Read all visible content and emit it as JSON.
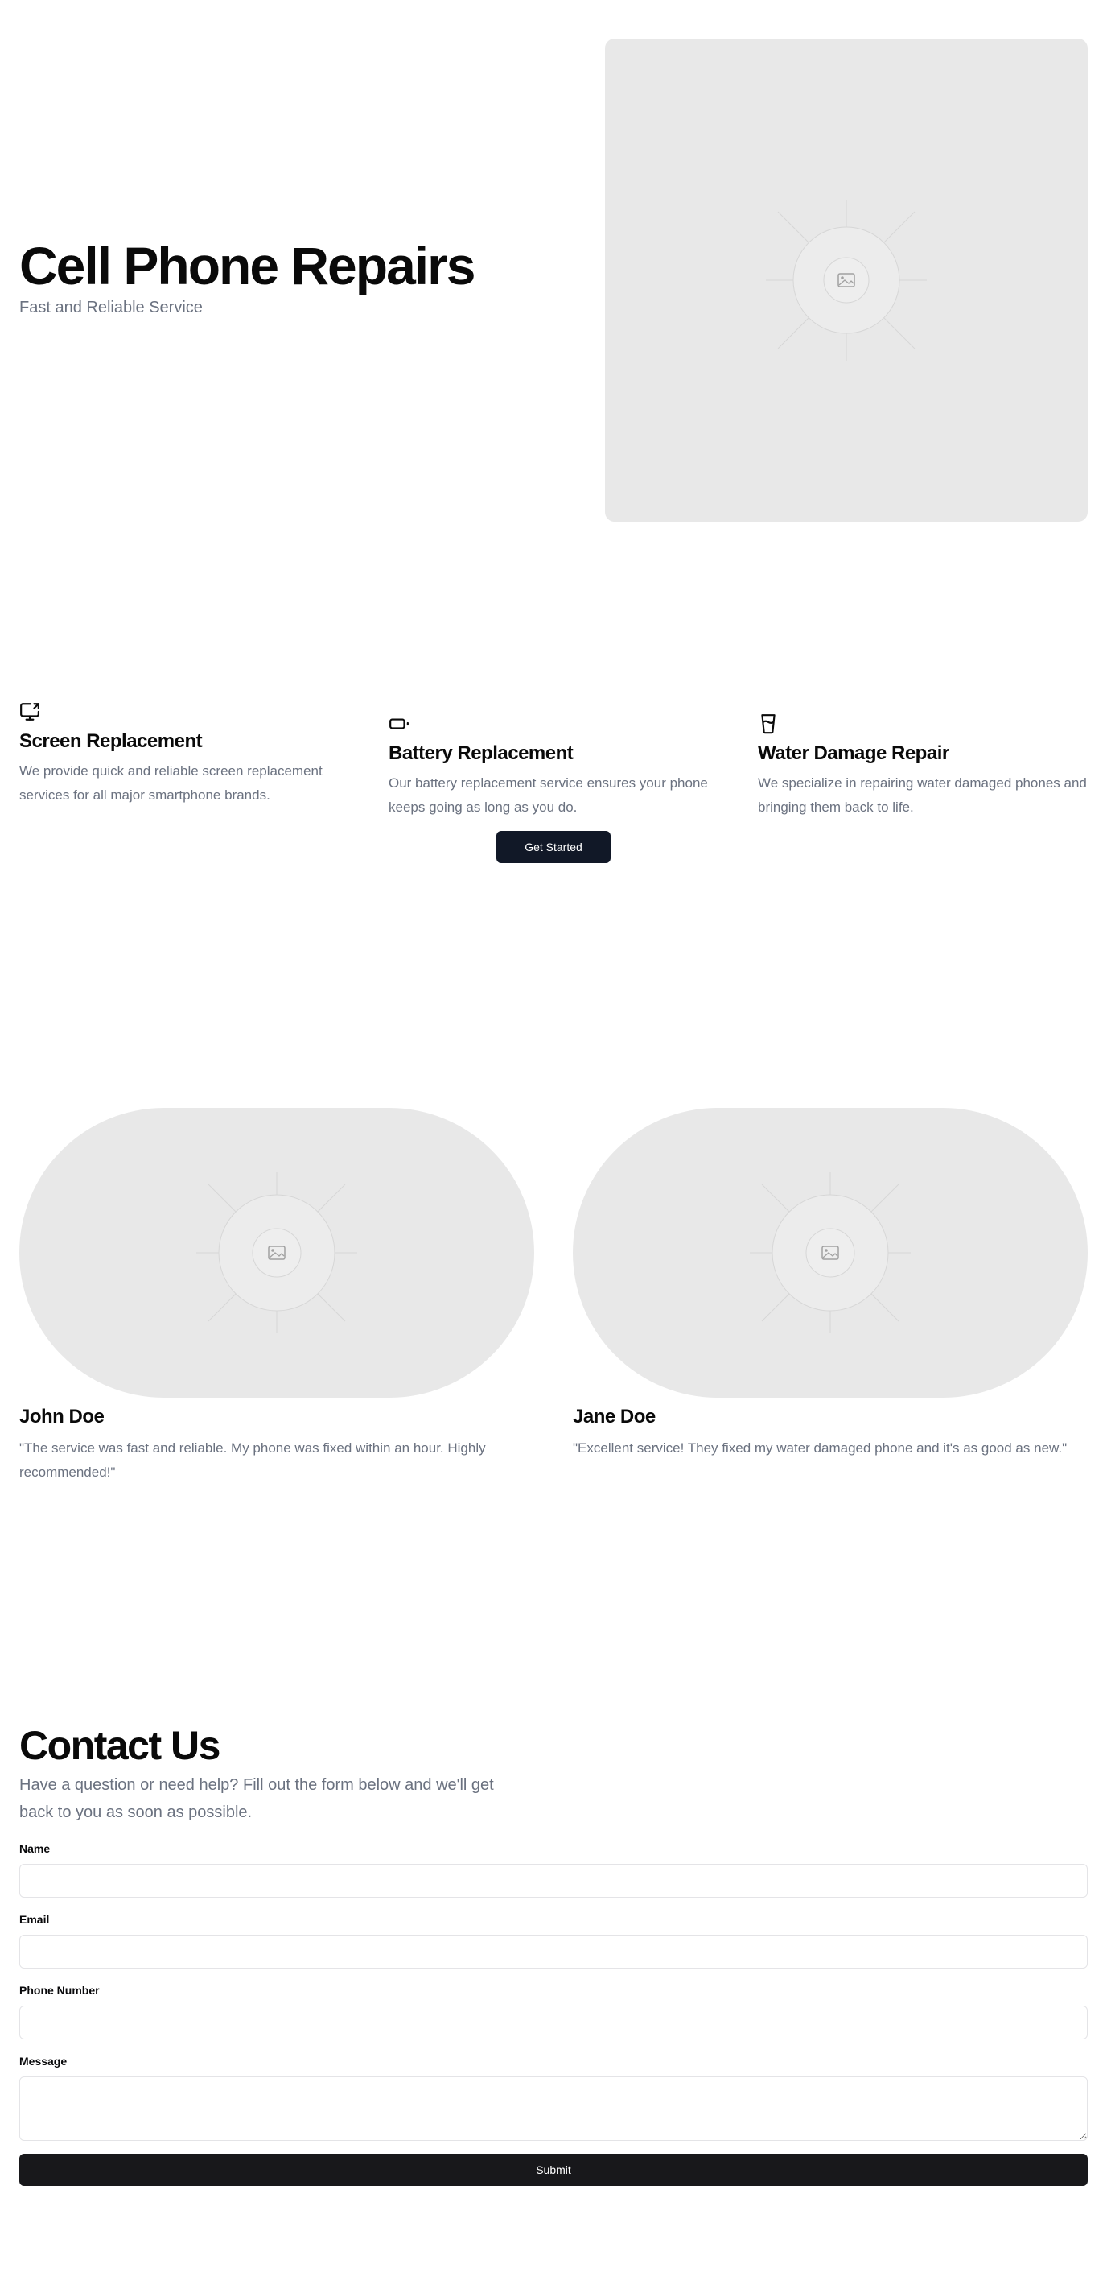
{
  "hero": {
    "title": "Cell Phone Repairs",
    "subtitle": "Fast and Reliable Service"
  },
  "features": [
    {
      "icon": "monitor-share-icon",
      "title": "Screen Replacement",
      "description": "We provide quick and reliable screen replacement services for all major smartphone brands."
    },
    {
      "icon": "battery-icon",
      "title": "Battery Replacement",
      "description": "Our battery replacement service ensures your phone keeps going as long as you do."
    },
    {
      "icon": "water-glass-icon",
      "title": "Water Damage Repair",
      "description": "We specialize in repairing water damaged phones and bringing them back to life."
    }
  ],
  "cta": {
    "label": "Get Started"
  },
  "testimonials": [
    {
      "name": "John Doe",
      "quote": "\"The service was fast and reliable. My phone was fixed within an hour. Highly recommended!\""
    },
    {
      "name": "Jane Doe",
      "quote": "\"Excellent service! They fixed my water damaged phone and it's as good as new.\""
    }
  ],
  "contact": {
    "title": "Contact Us",
    "subtitle": "Have a question or need help? Fill out the form below and we'll get back to you as soon as possible.",
    "fields": {
      "name_label": "Name",
      "name_value": "",
      "email_label": "Email",
      "email_value": "",
      "phone_label": "Phone Number",
      "phone_value": "",
      "message_label": "Message",
      "message_value": ""
    },
    "submit_label": "Submit"
  },
  "colors": {
    "primary_button": "#111827",
    "submit_button": "#18181b",
    "muted_text": "#6b7280",
    "placeholder_bg": "#e8e8e8"
  }
}
